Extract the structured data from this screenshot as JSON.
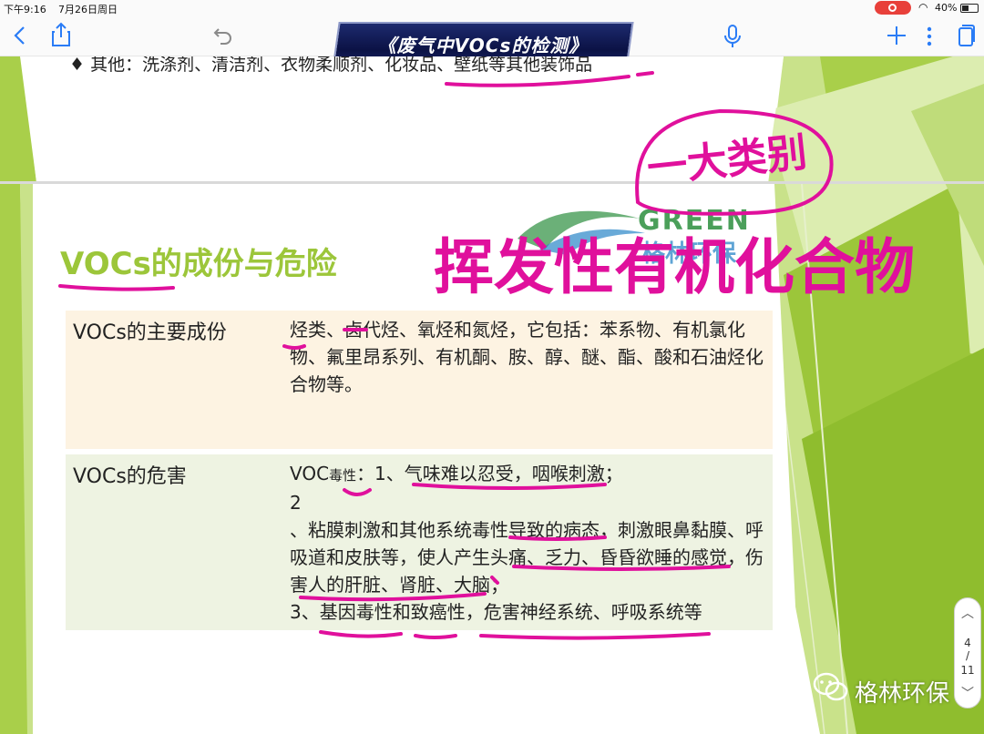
{
  "status": {
    "time": "下午9:16",
    "date": "7月26日周日",
    "battery": "40%"
  },
  "toolbar": {
    "title": "《废气中VOCs的检测》",
    "icons": [
      "back-icon",
      "share-icon",
      "undo-icon",
      "microphone-icon",
      "add-icon",
      "more-icon",
      "pages-icon"
    ]
  },
  "slide": {
    "prev_slide_text": "♦ 其他：洗涤剂、清洁剂、衣物柔顺剂、化妆品、壁纸等其他装饰品",
    "logo": {
      "brand": "GREEN",
      "sub": "格林环保"
    },
    "heading": "VOCs的成份与危险",
    "rows": [
      {
        "label": "VOCs的主要成份",
        "content": "烃类、卤代烃、氧烃和氮烃，它包括：苯系物、有机氯化物、氟里昂系列、有机酮、胺、醇、醚、酯、酸和石油烃化合物等。"
      },
      {
        "label": "VOCs的危害",
        "voc": "VOC",
        "toxic": "毒性",
        "item1": "：1、气味难以忍受，咽喉刺激；",
        "item2_num": "2",
        "item2": "、粘膜刺激和其他系统毒性导致的病态，刺激眼鼻黏膜、呼吸道和皮肤等，使人产生头痛、乏力、昏昏欲睡的感觉，伤害人的肝脏、肾脏、大脑；",
        "item3": "3、基因毒性和致癌性，危害神经系统、呼吸系统等"
      }
    ]
  },
  "annotations": {
    "circled_note": "一大类别",
    "main_note": "挥发性有机化合物",
    "ink_color": "#e0109c"
  },
  "page_nav": {
    "current": "4",
    "separator": "/",
    "total": "11"
  },
  "watermark": {
    "text": "格林环保"
  }
}
